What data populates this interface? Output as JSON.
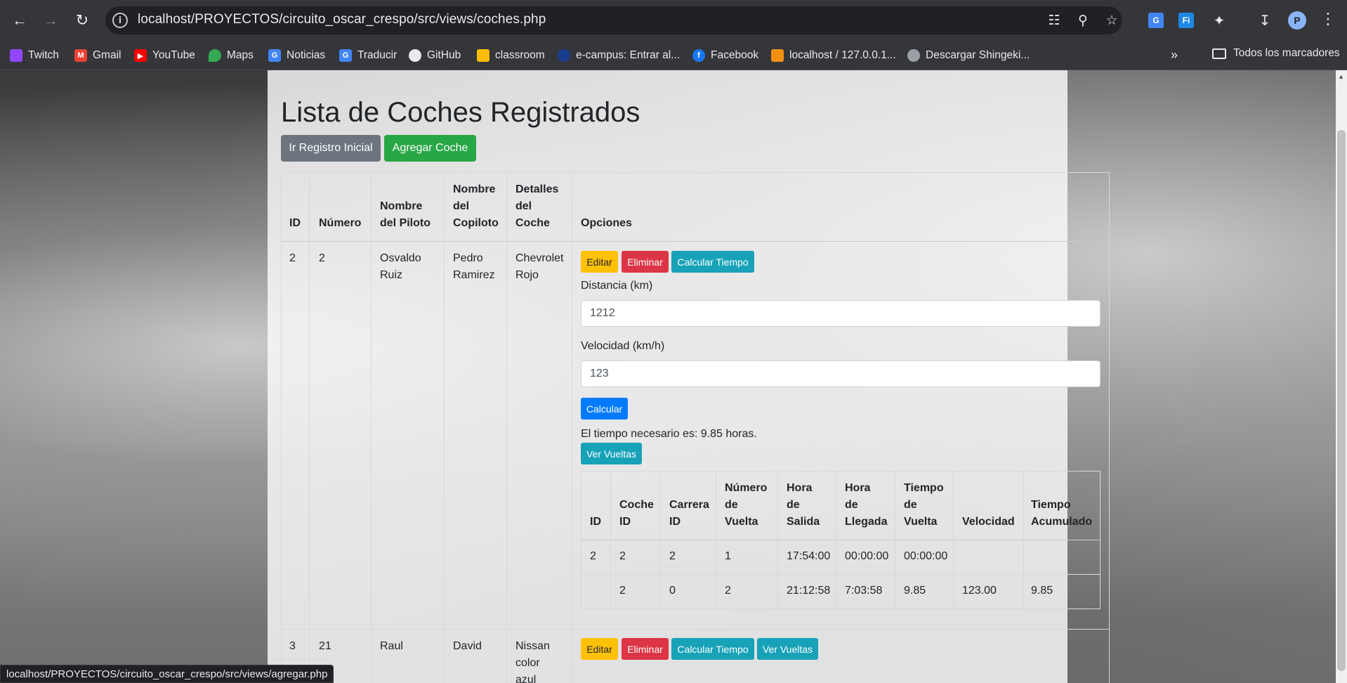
{
  "browser": {
    "url": "localhost/PROYECTOS/circuito_oscar_crespo/src/views/coches.php",
    "status_url": "localhost/PROYECTOS/circuito_oscar_crespo/src/views/agregar.php",
    "profile_initial": "P",
    "bookmarks": [
      {
        "label": "Twitch",
        "icon": "twitch-icon",
        "color": "#9146ff"
      },
      {
        "label": "Gmail",
        "icon": "gmail-icon",
        "color": "#ea4335"
      },
      {
        "label": "YouTube",
        "icon": "youtube-icon",
        "color": "#ff0000"
      },
      {
        "label": "Maps",
        "icon": "maps-icon",
        "color": "#34a853"
      },
      {
        "label": "Noticias",
        "icon": "news-icon",
        "color": "#4285f4"
      },
      {
        "label": "Traducir",
        "icon": "translate-icon",
        "color": "#4285f4"
      },
      {
        "label": "GitHub",
        "icon": "github-icon",
        "color": "#ffffff"
      },
      {
        "label": "classroom",
        "icon": "classroom-icon",
        "color": "#fbbc04"
      },
      {
        "label": "e-campus: Entrar al...",
        "icon": "ecampus-icon",
        "color": "#1a3d8f"
      },
      {
        "label": "Facebook",
        "icon": "facebook-icon",
        "color": "#1877f2"
      },
      {
        "label": "localhost / 127.0.0.1...",
        "icon": "phpmyadmin-icon",
        "color": "#f29111"
      },
      {
        "label": "Descargar Shingeki...",
        "icon": "globe-icon",
        "color": "#9aa0a6"
      }
    ],
    "all_bookmarks": "Todos los marcadores"
  },
  "page": {
    "title": "Lista de Coches Registrados",
    "btn_registro": "Ir Registro Inicial",
    "btn_agregar": "Agregar Coche"
  },
  "table": {
    "headers": {
      "id": "ID",
      "numero": "Número",
      "piloto": [
        "Nombre",
        "del Piloto"
      ],
      "copiloto": [
        "Nombre",
        "del",
        "Copiloto"
      ],
      "detalles": [
        "Detalles",
        "del",
        "Coche"
      ],
      "opciones": "Opciones"
    },
    "rows": [
      {
        "id": "2",
        "numero": "2",
        "piloto": [
          "Osvaldo",
          "Ruiz"
        ],
        "copiloto": [
          "Pedro",
          "Ramirez"
        ],
        "detalles": [
          "Chevrolet",
          "Rojo"
        ]
      },
      {
        "id": "3",
        "numero": "21",
        "piloto": [
          "Raul"
        ],
        "copiloto": [
          "David"
        ],
        "detalles": [
          "Nissan",
          "color",
          "azul"
        ]
      }
    ],
    "actions": {
      "editar": "Editar",
      "eliminar": "Eliminar",
      "calcular": "Calcular Tiempo",
      "ver_vueltas": "Ver Vueltas"
    }
  },
  "calc_form": {
    "distancia_label": "Distancia (km)",
    "distancia_value": "1212",
    "velocidad_label": "Velocidad (km/h)",
    "velocidad_value": "123",
    "submit": "Calcular",
    "result": "El tiempo necesario es: 9.85 horas."
  },
  "laps": {
    "headers": {
      "id": "ID",
      "coche": [
        "Coche",
        "ID"
      ],
      "carrera": [
        "Carrera",
        "ID"
      ],
      "numero": [
        "Número",
        "de",
        "Vuelta"
      ],
      "salida": [
        "Hora",
        "de",
        "Salida"
      ],
      "llegada": [
        "Hora",
        "de",
        "Llegada"
      ],
      "tiempo": [
        "Tiempo",
        "de",
        "Vuelta"
      ],
      "velocidad": "Velocidad",
      "acumulado": [
        "Tiempo",
        "Acumulado"
      ]
    },
    "rows": [
      {
        "id": "2",
        "coche": "2",
        "carrera": "2",
        "numero": "1",
        "salida": "17:54:00",
        "llegada": "00:00:00",
        "tiempo": "00:00:00",
        "velocidad": "",
        "acumulado": ""
      },
      {
        "id": "",
        "coche": "2",
        "carrera": "0",
        "numero": "2",
        "salida": "21:12:58",
        "llegada": "7:03:58",
        "tiempo": "9.85",
        "velocidad": "123.00",
        "acumulado": "9.85"
      }
    ]
  }
}
